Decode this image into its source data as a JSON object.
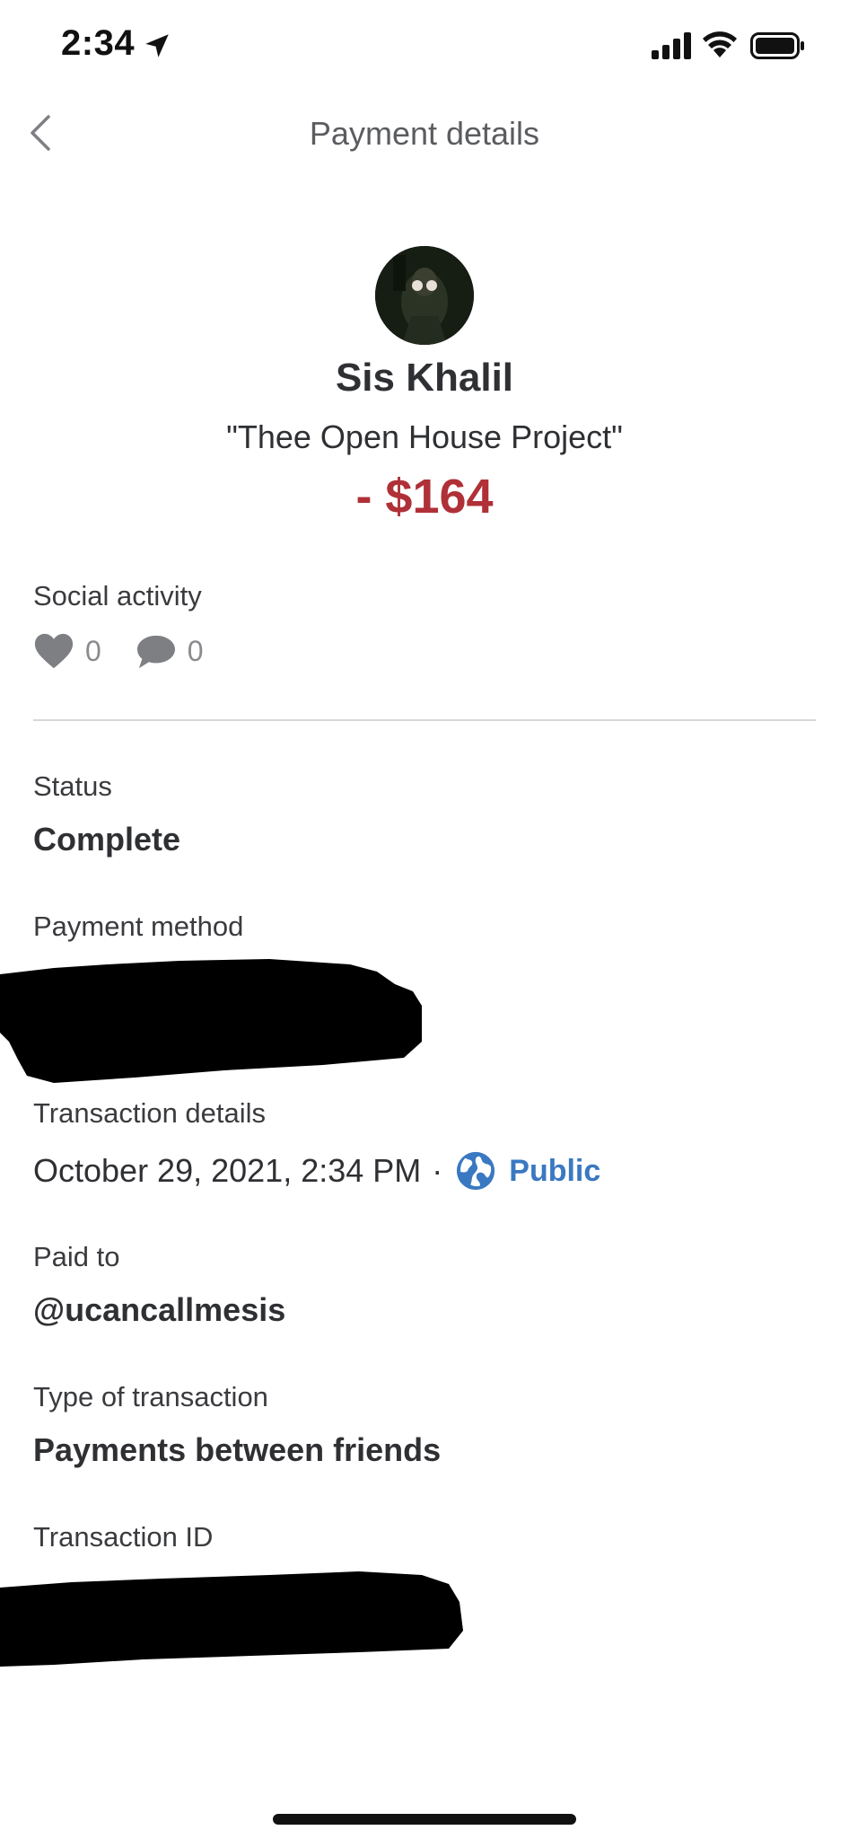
{
  "status_bar": {
    "time": "2:34"
  },
  "nav": {
    "title": "Payment details"
  },
  "payment": {
    "name": "Sis Khalil",
    "note": "\"Thee Open House Project\"",
    "amount": "- $164"
  },
  "social": {
    "label": "Social activity",
    "likes": "0",
    "comments": "0"
  },
  "details": {
    "status_label": "Status",
    "status_value": "Complete",
    "method_label": "Payment method",
    "transaction_label": "Transaction details",
    "transaction_datetime": "October 29, 2021, 2:34 PM",
    "separator": "·",
    "visibility": "Public",
    "paid_to_label": "Paid to",
    "paid_to_value": "@ucancallmesis",
    "type_label": "Type of transaction",
    "type_value": "Payments between friends",
    "id_label": "Transaction ID"
  },
  "colors": {
    "amount": "#b03037",
    "link": "#3a78c2",
    "icon_gray": "#7e7f83"
  }
}
